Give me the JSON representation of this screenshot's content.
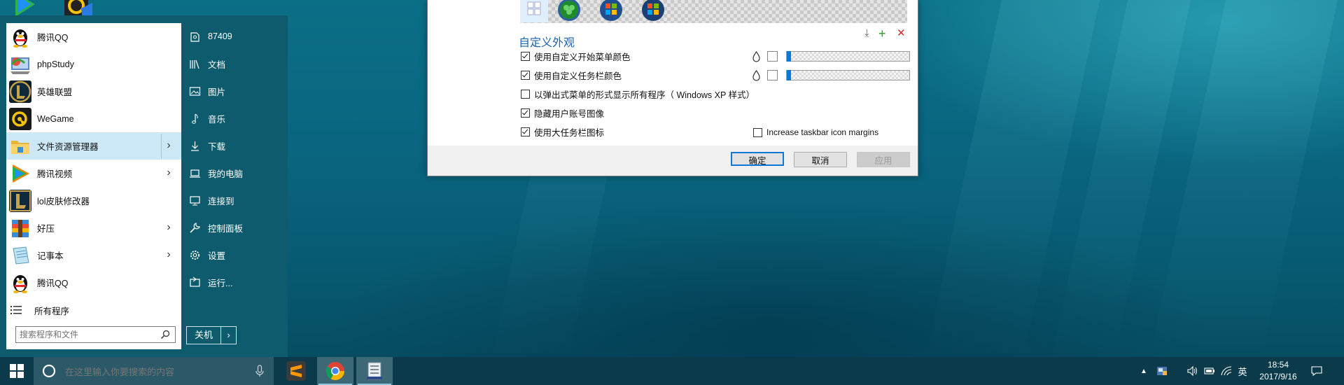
{
  "start_menu": {
    "apps": [
      {
        "label": "腾讯QQ",
        "icon": "qq-penguin-icon",
        "has_submenu": false
      },
      {
        "label": "phpStudy",
        "icon": "phpstudy-icon",
        "has_submenu": false
      },
      {
        "label": "英雄联盟",
        "icon": "league-of-legends-icon",
        "has_submenu": false
      },
      {
        "label": "WeGame",
        "icon": "wegame-icon",
        "has_submenu": false
      },
      {
        "label": "文件资源管理器",
        "icon": "file-explorer-icon",
        "has_submenu": true,
        "highlighted": true
      },
      {
        "label": "腾讯视频",
        "icon": "tencent-video-icon",
        "has_submenu": true
      },
      {
        "label": "lol皮肤修改器",
        "icon": "lol-skin-tool-icon",
        "has_submenu": false
      },
      {
        "label": "好压",
        "icon": "haozip-icon",
        "has_submenu": true
      },
      {
        "label": "记事本",
        "icon": "notepad-icon",
        "has_submenu": true
      },
      {
        "label": "腾讯QQ",
        "icon": "qq-penguin-icon",
        "has_submenu": false
      }
    ],
    "all_programs": "所有程序",
    "search_placeholder": "搜索程序和文件",
    "right_items": [
      {
        "label": "87409",
        "icon": "user-folder-icon"
      },
      {
        "label": "文档",
        "icon": "documents-icon"
      },
      {
        "label": "图片",
        "icon": "pictures-icon"
      },
      {
        "label": "音乐",
        "icon": "music-icon"
      },
      {
        "label": "下载",
        "icon": "download-icon"
      },
      {
        "label": "我的电脑",
        "icon": "computer-icon"
      },
      {
        "label": "连接到",
        "icon": "connect-to-icon"
      },
      {
        "label": "控制面板",
        "icon": "control-panel-icon"
      },
      {
        "label": "设置",
        "icon": "settings-gear-icon"
      },
      {
        "label": "运行...",
        "icon": "run-icon"
      }
    ],
    "shutdown_label": "关机",
    "shutdown_arrow": "›"
  },
  "dialog": {
    "section_title": "自定义外观",
    "options": [
      {
        "label": "使用自定义开始菜单颜色",
        "checked": true
      },
      {
        "label": "使用自定义任务栏颜色",
        "checked": true
      },
      {
        "label": "以弹出式菜单的形式显示所有程序（ Windows XP 样式）",
        "checked": false
      },
      {
        "label": "隐藏用户账号图像",
        "checked": true
      },
      {
        "label": "使用大任务栏图标",
        "checked": true
      }
    ],
    "extra_option": {
      "label": "Increase taskbar icon margins",
      "checked": false
    },
    "buttons": {
      "ok": "确定",
      "cancel": "取消",
      "apply": "应用"
    },
    "colors": {
      "accent": "#0a78d7",
      "title": "#1a63b0"
    }
  },
  "taskbar": {
    "search_placeholder": "在这里输入你要搜索的内容",
    "ime_label": "英",
    "time": "18:54",
    "date": "2017/9/16",
    "pinned_apps": [
      "sublime-text-icon",
      "chrome-icon",
      "classic-shell-icon"
    ]
  }
}
